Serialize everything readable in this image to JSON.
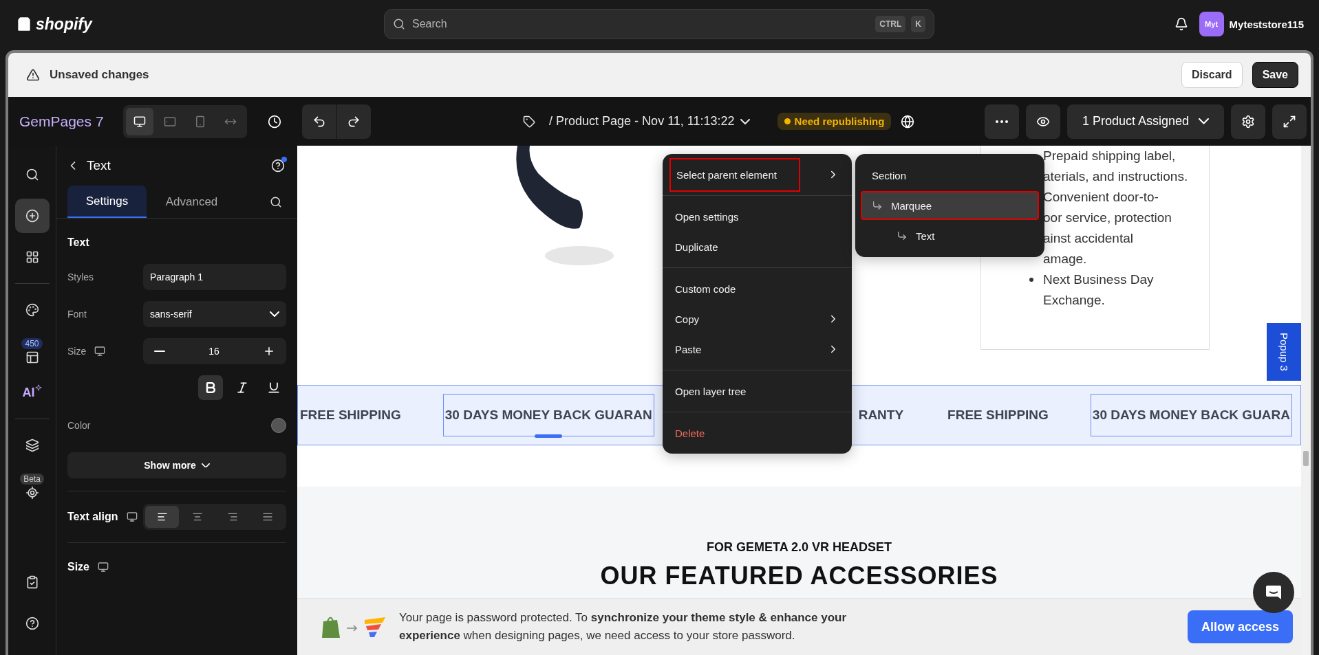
{
  "topbar": {
    "logo": "shopify",
    "search": {
      "placeholder": "Search",
      "keys": [
        "CTRL",
        "K"
      ]
    },
    "avatar": "Myt",
    "store": "Myteststore115"
  },
  "unsaved": {
    "message": "Unsaved changes",
    "buttons": [
      {
        "label": "Discard",
        "kind": "secondary"
      },
      {
        "label": "Save",
        "kind": "primary"
      }
    ]
  },
  "toolbar": {
    "brand": "GemPages 7",
    "devices": [
      {
        "kind": "desktop",
        "selected": true
      },
      {
        "kind": "tablet",
        "selected": false
      },
      {
        "kind": "mobile",
        "selected": false
      },
      {
        "kind": "fit",
        "selected": false
      }
    ],
    "page_title": "/ Product Page - Nov 11, 11:13:22",
    "status": "Need republishing",
    "assigned": "1 Product Assigned"
  },
  "rail": {
    "top": [
      {
        "kind": "search",
        "selected": false
      },
      {
        "kind": "add",
        "selected": true
      },
      {
        "kind": "elements",
        "selected": false
      },
      {
        "kind": "divider"
      },
      {
        "kind": "theme",
        "selected": false
      },
      {
        "kind": "templates",
        "badge": "450",
        "selected": false
      },
      {
        "kind": "ai",
        "label": "AI",
        "selected": false
      },
      {
        "kind": "divider"
      },
      {
        "kind": "layers",
        "selected": false
      },
      {
        "kind": "target",
        "badge": "Beta",
        "selected": false
      }
    ],
    "bottom": [
      {
        "kind": "tasks",
        "selected": false
      },
      {
        "kind": "help",
        "selected": false
      }
    ]
  },
  "panel": {
    "title": "Text",
    "tabs": [
      {
        "label": "Settings",
        "selected": true
      },
      {
        "label": "Advanced",
        "selected": false
      }
    ],
    "section": "Text",
    "styles": {
      "label": "Styles",
      "value": "Paragraph 1"
    },
    "font": {
      "label": "Font",
      "value": "sans-serif"
    },
    "size": {
      "label": "Size",
      "value": "16"
    },
    "format": [
      {
        "kind": "bold",
        "selected": true
      },
      {
        "kind": "italic",
        "selected": false
      },
      {
        "kind": "underline",
        "selected": false
      }
    ],
    "color_label": "Color",
    "show_more": "Show more",
    "text_align": {
      "label": "Text align",
      "options": [
        {
          "kind": "left",
          "selected": true
        },
        {
          "kind": "center",
          "selected": false
        },
        {
          "kind": "right",
          "selected": false
        },
        {
          "kind": "justify",
          "selected": false
        }
      ]
    },
    "size_section": "Size"
  },
  "canvas": {
    "features": [
      {
        "lines": [
          "Prepaid shipping label,",
          "aterials, and instructions."
        ]
      },
      {
        "lines": [
          "Convenient door-to-",
          "oor service, protection",
          "ainst accidental",
          "amage."
        ]
      },
      {
        "lines": [
          "Next Business Day",
          "Exchange."
        ]
      }
    ],
    "marquee": [
      {
        "text": "FREE SHIPPING",
        "selected": false,
        "outlined": false
      },
      {
        "text": "30 DAYS MONEY BACK GUARAN",
        "selected": true,
        "outlined": true
      },
      {
        "text": "RANTY",
        "selected": false,
        "outlined": false
      },
      {
        "text": "FREE SHIPPING",
        "selected": false,
        "outlined": false
      },
      {
        "text": "30 DAYS MONEY BACK GUARA",
        "selected": false,
        "outlined": true
      }
    ],
    "eyebrow": "FOR GEMETA 2.0 VR HEADSET",
    "heading": "OUR FEATURED ACCESSORIES",
    "popup_tab": "Popup 3"
  },
  "context_menu": {
    "groups": [
      {
        "items": [
          {
            "label": "Select parent element",
            "kind": "action",
            "submenu": true,
            "highlighted": true
          }
        ]
      },
      {
        "items": [
          {
            "label": "Open settings",
            "kind": "action",
            "submenu": false,
            "highlighted": false
          },
          {
            "label": "Duplicate",
            "kind": "action",
            "submenu": false,
            "highlighted": false
          }
        ]
      },
      {
        "items": [
          {
            "label": "Custom code",
            "kind": "action",
            "submenu": false,
            "highlighted": false
          },
          {
            "label": "Copy",
            "kind": "action",
            "submenu": true,
            "highlighted": false
          },
          {
            "label": "Paste",
            "kind": "action",
            "submenu": true,
            "highlighted": false
          }
        ]
      },
      {
        "items": [
          {
            "label": "Open layer tree",
            "kind": "action",
            "submenu": false,
            "highlighted": false
          }
        ]
      },
      {
        "items": [
          {
            "label": "Delete",
            "kind": "danger",
            "submenu": false,
            "highlighted": false
          }
        ]
      }
    ]
  },
  "submenu": {
    "items": [
      {
        "label": "Section",
        "selected": false,
        "highlighted": false,
        "children": [
          {
            "label": "Marquee",
            "selected": true,
            "highlighted": true,
            "children": [
              {
                "label": "Text",
                "selected": false,
                "highlighted": false
              }
            ]
          }
        ]
      }
    ]
  },
  "banner": {
    "text": "Your page is password protected. To **synchronize your theme style & enhance your experience** when designing pages, we need access to your store password.",
    "button": "Allow access"
  }
}
